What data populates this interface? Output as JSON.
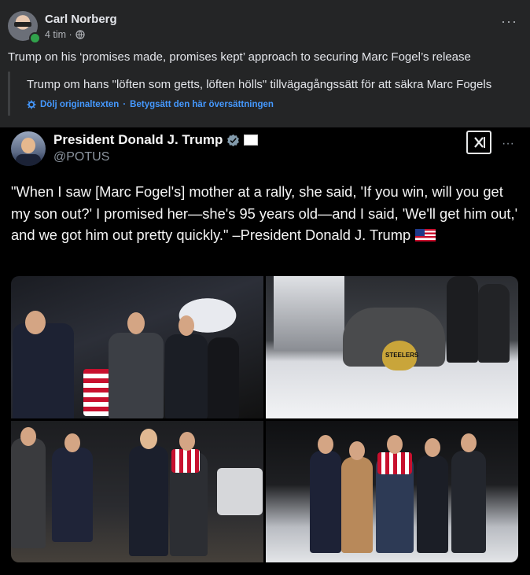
{
  "post": {
    "author": "Carl Norberg",
    "time": "4 tim ·",
    "more_icon": "more-horizontal-icon",
    "caption": "Trump on his ‘promises made, promises kept’ approach to securing Marc Fogel’s release",
    "translation": {
      "text": "Trump om hans \"löften som getts, löften hölls\" tillvägagångssätt för att säkra Marc Fogels",
      "hide_original": "Dölj originaltexten",
      "separator": "·",
      "rate_translation": "Betygsätt den här översättningen"
    }
  },
  "tweet": {
    "name": "President Donald J. Trump",
    "handle": "@POTUS",
    "text": "\"When I saw [Marc Fogel's] mother at a rally, she said, 'If you win, will you get my son out?' I promised her—she's 95 years old—and I said, 'We'll get him out,' and we got him out pretty quickly.\" –President Donald J. Trump",
    "flag_icon": "us-flag-icon",
    "more_icon": "more-horizontal-icon",
    "logo_icon": "x-logo-icon",
    "photo_beanie_text": "STEELERS"
  },
  "colors": {
    "card_bg": "#242526",
    "tweet_bg": "#000000",
    "link": "#4599ff",
    "verified": "#829aab",
    "online": "#31a24c"
  }
}
